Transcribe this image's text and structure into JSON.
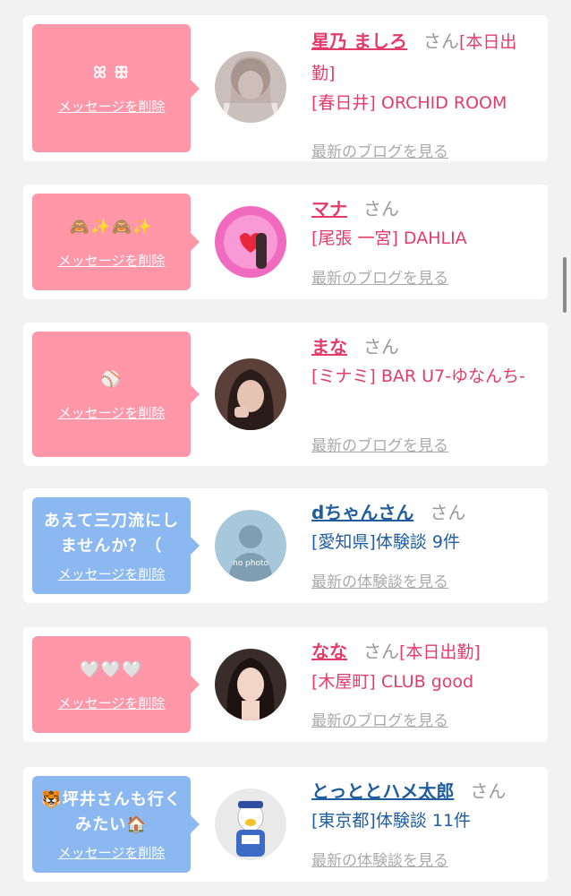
{
  "delete_label": "メッセージを削除",
  "san_label": "さん",
  "items": [
    {
      "message": "ꕤ ꕥ",
      "name": "星乃 ましろ",
      "badge": "[本日出勤]",
      "shop": "[春日井] ORCHID ROOM",
      "link": "最新のブログを見る"
    },
    {
      "message": "🙈✨🙈✨",
      "name": "マナ",
      "badge": "",
      "shop": "[尾張 一宮] DAHLIA",
      "link": "最新のブログを見る"
    },
    {
      "message": "⚾",
      "name": "まな",
      "badge": "",
      "shop": "[ミナミ] BAR U7-ゆなんち-",
      "link": "最新のブログを見る"
    },
    {
      "message": "あえて三刀流にしませんか？（",
      "name": "dちゃんさん",
      "badge": "",
      "shop": "[愛知県]体験談 9件",
      "link": "最新の体験談を見る",
      "avatar_text": "no photo"
    },
    {
      "message": "🤍🤍🤍",
      "name": "なな",
      "badge": "[本日出勤]",
      "shop": "[木屋町] CLUB good",
      "link": "最新のブログを見る"
    },
    {
      "message": "🐯坪井さんも行くみたい🏠",
      "name": "とっととハメ太郎",
      "badge": "",
      "shop": "[東京都]体験談 11件",
      "link": "最新の体験談を見る"
    }
  ],
  "colors": {
    "pink_bubble": "#ff97a9",
    "blue_bubble": "#8cb8f2",
    "pink_text": "#e43b6b",
    "blue_text": "#1f5d9e"
  }
}
